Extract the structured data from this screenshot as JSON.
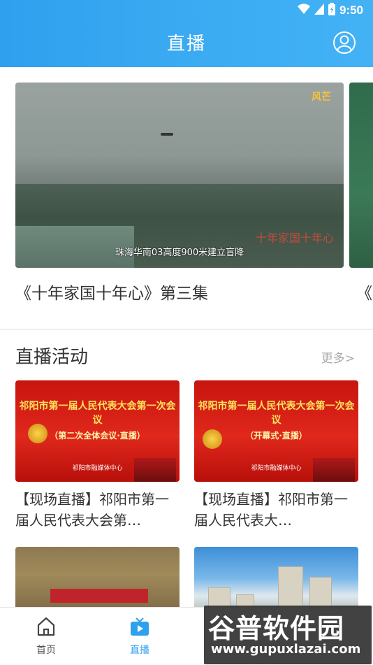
{
  "status_bar": {
    "time": "9:50"
  },
  "header": {
    "title": "直播"
  },
  "carousel": {
    "items": [
      {
        "title": "《十年家国十年心》第三集",
        "caption": "珠海华南03高度900米建立盲降",
        "logo": "风芒",
        "stamp": "十年家国十年心"
      },
      {
        "title": "《十"
      }
    ]
  },
  "live_section": {
    "title": "直播活动",
    "more_label": "更多>",
    "cards": [
      {
        "title": "【现场直播】祁阳市第一届人民代表大会第…",
        "banner": "祁阳市第一届人民代表大会第一次会议",
        "subtitle": "（第二次全体会议·直播）",
        "footer": "祁阳市融媒体中心"
      },
      {
        "title": "【现场直播】祁阳市第一届人民代表大…",
        "banner": "祁阳市第一届人民代表大会第一次会议",
        "subtitle": "（开幕式·直播）",
        "footer": "祁阳市融媒体中心"
      },
      {
        "title": ""
      },
      {
        "title": ""
      }
    ]
  },
  "bottom_nav": {
    "items": [
      {
        "label": "首页",
        "icon": "home-icon",
        "active": false
      },
      {
        "label": "直播",
        "icon": "tv-icon",
        "active": true
      }
    ]
  },
  "watermark": {
    "brand": "谷普软件园",
    "url": "www.gupuxlazai.com"
  },
  "colors": {
    "primary": "#2fa0ee",
    "text": "#333333",
    "muted": "#aaaaaa"
  }
}
